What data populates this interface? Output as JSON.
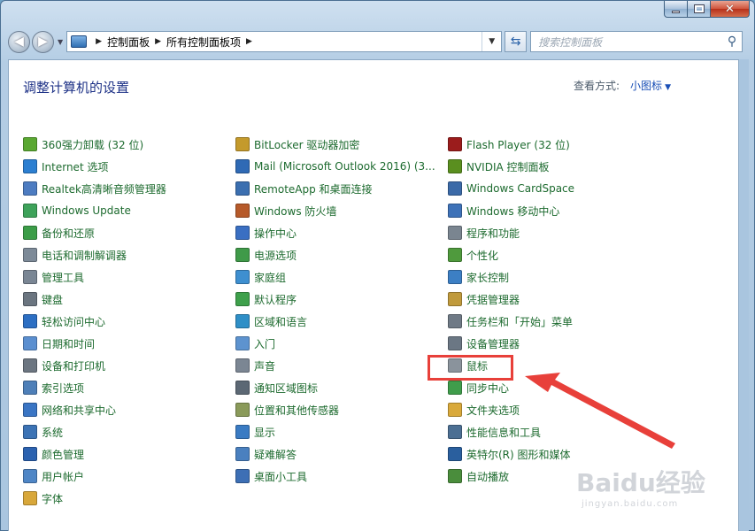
{
  "window": {
    "caption": {
      "minimize": "–",
      "maximize": "□",
      "close": "✕"
    }
  },
  "navbar": {
    "breadcrumb": [
      "控制面板",
      "所有控制面板项"
    ],
    "search_placeholder": "搜索控制面板"
  },
  "header": {
    "title": "调整计算机的设置",
    "view_label": "查看方式:",
    "view_value": "小图标"
  },
  "columns": [
    [
      {
        "label": "360强力卸载 (32 位)",
        "icon": "uninstall-icon",
        "color": "#5aa832"
      },
      {
        "label": "Internet 选项",
        "icon": "globe-icon",
        "color": "#2c7fd1"
      },
      {
        "label": "Realtek高清晰音频管理器",
        "icon": "speaker-icon",
        "color": "#4d7cc1"
      },
      {
        "label": "Windows Update",
        "icon": "update-icon",
        "color": "#3ea25a"
      },
      {
        "label": "备份和还原",
        "icon": "backup-icon",
        "color": "#3c9d48"
      },
      {
        "label": "电话和调制解调器",
        "icon": "phone-icon",
        "color": "#7d8a98"
      },
      {
        "label": "管理工具",
        "icon": "tools-icon",
        "color": "#7a8694"
      },
      {
        "label": "键盘",
        "icon": "keyboard-icon",
        "color": "#6b7580"
      },
      {
        "label": "轻松访问中心",
        "icon": "accessibility-icon",
        "color": "#2d6fc3"
      },
      {
        "label": "日期和时间",
        "icon": "clock-icon",
        "color": "#5b8fd0"
      },
      {
        "label": "设备和打印机",
        "icon": "printer-icon",
        "color": "#6c7681"
      },
      {
        "label": "索引选项",
        "icon": "magnifier-icon",
        "color": "#4e7fb8"
      },
      {
        "label": "网络和共享中心",
        "icon": "network-icon",
        "color": "#3a75c4"
      },
      {
        "label": "系统",
        "icon": "system-icon",
        "color": "#3c73b5"
      },
      {
        "label": "颜色管理",
        "icon": "color-icon",
        "color": "#2b62b0"
      },
      {
        "label": "用户帐户",
        "icon": "users-icon",
        "color": "#4f86c6"
      },
      {
        "label": "字体",
        "icon": "font-icon",
        "color": "#d8a73a"
      }
    ],
    [
      {
        "label": "BitLocker 驱动器加密",
        "icon": "key-icon",
        "color": "#c49a2c"
      },
      {
        "label": "Mail (Microsoft Outlook 2016) (3...",
        "icon": "mail-icon",
        "color": "#2f6ab5"
      },
      {
        "label": "RemoteApp 和桌面连接",
        "icon": "remote-icon",
        "color": "#3b6fb0"
      },
      {
        "label": "Windows 防火墙",
        "icon": "firewall-icon",
        "color": "#b65a2a"
      },
      {
        "label": "操作中心",
        "icon": "flag-icon",
        "color": "#3a6fc2"
      },
      {
        "label": "电源选项",
        "icon": "power-icon",
        "color": "#3f9a49"
      },
      {
        "label": "家庭组",
        "icon": "homegroup-icon",
        "color": "#3e8fd0"
      },
      {
        "label": "默认程序",
        "icon": "default-programs-icon",
        "color": "#3ea04b"
      },
      {
        "label": "区域和语言",
        "icon": "region-icon",
        "color": "#2f8fc7"
      },
      {
        "label": "入门",
        "icon": "getting-started-icon",
        "color": "#5d93cf"
      },
      {
        "label": "声音",
        "icon": "sound-icon",
        "color": "#7b8693"
      },
      {
        "label": "通知区域图标",
        "icon": "notification-icon",
        "color": "#5c6874"
      },
      {
        "label": "位置和其他传感器",
        "icon": "sensor-icon",
        "color": "#8a9a5a"
      },
      {
        "label": "显示",
        "icon": "display-icon",
        "color": "#3a7bc3"
      },
      {
        "label": "疑难解答",
        "icon": "troubleshoot-icon",
        "color": "#4a80bf"
      },
      {
        "label": "桌面小工具",
        "icon": "gadget-icon",
        "color": "#3d6fb5"
      }
    ],
    [
      {
        "label": "Flash Player (32 位)",
        "icon": "flash-icon",
        "color": "#9b1c1c"
      },
      {
        "label": "NVIDIA 控制面板",
        "icon": "nvidia-icon",
        "color": "#5a8f1f"
      },
      {
        "label": "Windows CardSpace",
        "icon": "cardspace-icon",
        "color": "#3b6aa8"
      },
      {
        "label": "Windows 移动中心",
        "icon": "mobility-icon",
        "color": "#3e72b8"
      },
      {
        "label": "程序和功能",
        "icon": "programs-icon",
        "color": "#7a8590"
      },
      {
        "label": "个性化",
        "icon": "personalize-icon",
        "color": "#4f9a3d"
      },
      {
        "label": "家长控制",
        "icon": "parental-icon",
        "color": "#3c7fc4"
      },
      {
        "label": "凭据管理器",
        "icon": "credential-icon",
        "color": "#c09a3c"
      },
      {
        "label": "任务栏和「开始」菜单",
        "icon": "taskbar-icon",
        "color": "#6f7a86"
      },
      {
        "label": "设备管理器",
        "icon": "device-manager-icon",
        "color": "#6b7784"
      },
      {
        "label": "鼠标",
        "icon": "mouse-icon",
        "color": "#8a939c"
      },
      {
        "label": "同步中心",
        "icon": "sync-icon",
        "color": "#3f9d4b"
      },
      {
        "label": "文件夹选项",
        "icon": "folder-icon",
        "color": "#d9a93b"
      },
      {
        "label": "性能信息和工具",
        "icon": "performance-icon",
        "color": "#4c6f93"
      },
      {
        "label": "英特尔(R) 图形和媒体",
        "icon": "intel-icon",
        "color": "#2a5f9e"
      },
      {
        "label": "自动播放",
        "icon": "autoplay-icon",
        "color": "#4a8d3c"
      }
    ]
  ],
  "annotation": {
    "highlight_color": "#e8403a"
  },
  "watermark": {
    "brand": "Bai",
    "brand_mid": "du",
    "brand_cn": "经验",
    "url": "jingyan.baidu.com"
  }
}
